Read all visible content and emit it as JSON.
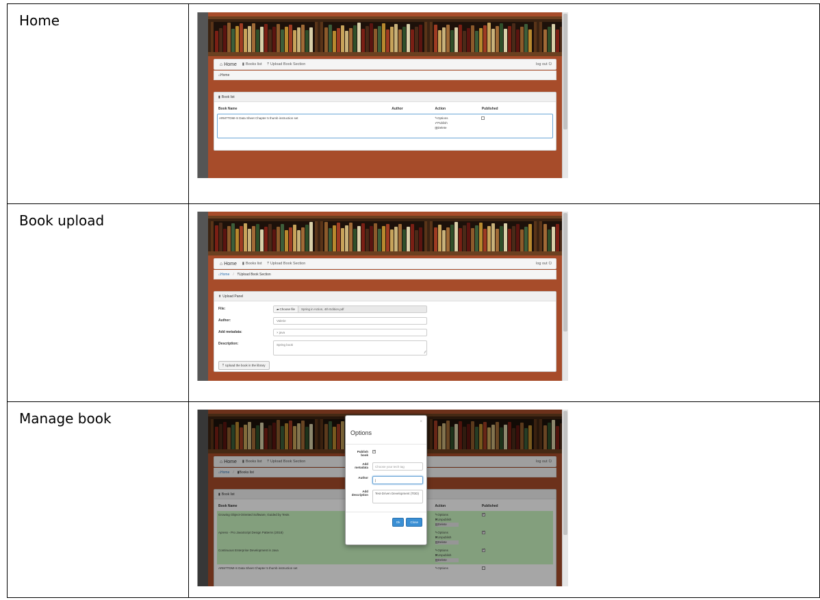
{
  "rows": [
    {
      "label": "Home"
    },
    {
      "label": "Book upload"
    },
    {
      "label": "Manage book"
    }
  ],
  "nav": {
    "home": "Home",
    "books_list": "Books list",
    "upload_section": "Upload Book Section",
    "logout": "log out"
  },
  "home_shot": {
    "crumb_home": "Home",
    "panel_title": "Book list",
    "columns": {
      "name": "Book Name",
      "author": "Author",
      "action": "Action",
      "published": "Published"
    },
    "row": {
      "name": "ARM7TDMI-S Data Sheet Chapter 5 thumb instruction set",
      "author": "",
      "actions": [
        "Options",
        "Publish",
        "Delete"
      ]
    }
  },
  "upload_shot": {
    "crumb_home": "Home",
    "crumb_current": "Upload Book Section",
    "panel_title": "Upload Panel",
    "file_label": "File:",
    "choose_file": "Choose file",
    "file_name": "Spring in Action, 4th Edition.pdf",
    "author_label": "Author:",
    "author_value": "Valerie",
    "metadata_label": "Add metadata:",
    "metadata_value": "× java",
    "description_label": "Description:",
    "description_value": "Spring book",
    "upload_button": "Upload the book in the library"
  },
  "manage_shot": {
    "crumb_home": "Home",
    "crumb_current": "Books list",
    "panel_title": "Book list",
    "columns": {
      "name": "Book Name",
      "author": "Author",
      "action": "Action",
      "published": "Published"
    },
    "rows": [
      {
        "name": "Growing Object-Oriented Software, Guided by Tests",
        "author": "",
        "actions": [
          "Options",
          "Unpublish",
          "Delete"
        ]
      },
      {
        "name": "Apress - Pro JavaScript Design Patterns (2018)",
        "author": "css",
        "actions": [
          "Options",
          "Unpublish",
          "Delete"
        ]
      },
      {
        "name": "Continuous Enterprise Development in Java",
        "author": "",
        "actions": [
          "Options",
          "Unpublish",
          "Delete"
        ]
      },
      {
        "name": "ARM7TDMI-S Data Sheet Chapter 5 thumb instruction set",
        "author": "",
        "actions": [
          "Options"
        ]
      }
    ],
    "modal": {
      "title": "Options",
      "close": "×",
      "publish_label": "Publish book",
      "metadata_label": "Add metadata",
      "metadata_placeholder": "Choose your tech tag",
      "author_label": "Author",
      "author_value": "|",
      "description_label": "Add description",
      "description_value": "Test-Driven Development (TDD)",
      "ok": "Ok",
      "close_button": "Close"
    }
  },
  "colors": {
    "wall": "#a74c2a",
    "highlight_green": "#c9f5c0",
    "primary_blue": "#3a8fd4"
  }
}
